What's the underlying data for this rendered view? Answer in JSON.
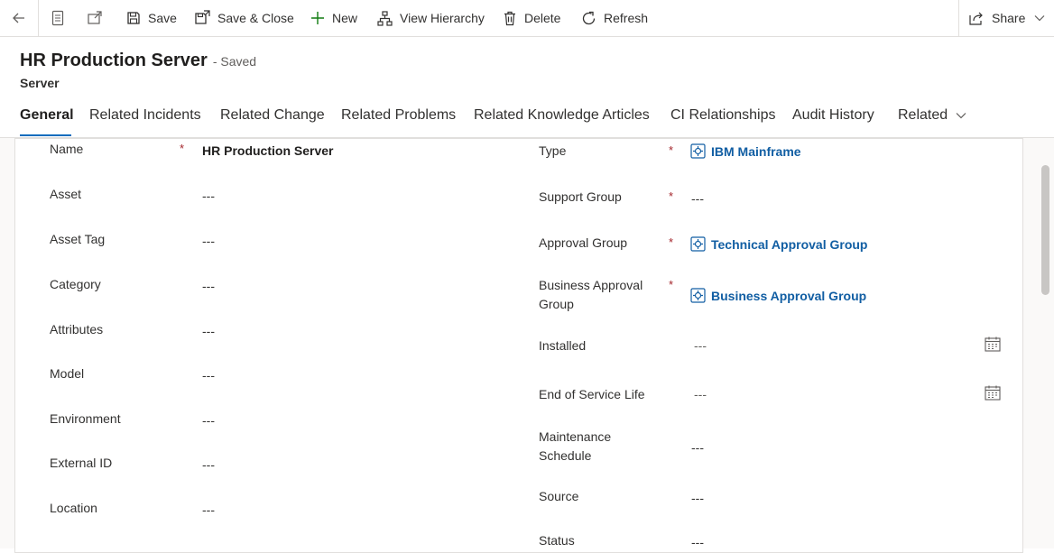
{
  "toolbar": {
    "save": "Save",
    "save_close": "Save & Close",
    "new": "New",
    "view_hierarchy": "View Hierarchy",
    "delete": "Delete",
    "refresh": "Refresh",
    "share": "Share"
  },
  "header": {
    "title": "HR Production Server",
    "saved": "- Saved",
    "entity": "Server"
  },
  "tabs": [
    {
      "label": "General"
    },
    {
      "label": "Related Incidents"
    },
    {
      "label": "Related Change"
    },
    {
      "label": "Related Problems"
    },
    {
      "label": "Related Knowledge Articles"
    },
    {
      "label": "CI Relationships"
    },
    {
      "label": "Audit History"
    },
    {
      "label": "Related"
    }
  ],
  "left_fields": [
    {
      "label": "Name",
      "value": "HR Production Server",
      "required": "*"
    },
    {
      "label": "Asset",
      "value": "---"
    },
    {
      "label": "Asset Tag",
      "value": "---"
    },
    {
      "label": "Category",
      "value": "---"
    },
    {
      "label": "Attributes",
      "value": "---"
    },
    {
      "label": "Model",
      "value": "---"
    },
    {
      "label": "Environment",
      "value": "---"
    },
    {
      "label": "External ID",
      "value": "---"
    },
    {
      "label": "Location",
      "value": "---"
    }
  ],
  "right_fields": {
    "type": {
      "label": "Type",
      "value": "IBM Mainframe",
      "required": "*"
    },
    "support_group": {
      "label": "Support Group",
      "value": "---",
      "required": "*"
    },
    "approval_group": {
      "label": "Approval Group",
      "value": "Technical Approval Group",
      "required": "*"
    },
    "business_approval_group": {
      "label_line1": "Business Approval",
      "label_line2": "Group",
      "value": "Business Approval Group",
      "required": "*"
    },
    "installed": {
      "label": "Installed",
      "value": "---"
    },
    "end_of_service_life": {
      "label": "End of Service Life",
      "value": "---"
    },
    "maintenance_schedule": {
      "label_line1": "Maintenance",
      "label_line2": "Schedule",
      "value": "---"
    },
    "source": {
      "label": "Source",
      "value": "---"
    },
    "status": {
      "label": "Status",
      "value": "---"
    }
  },
  "colors": {
    "accent": "#0f6cbd",
    "link": "#115ea3",
    "required": "#a4262c"
  },
  "icons": [
    "back-arrow-icon",
    "form-icon",
    "popout-icon",
    "save-icon",
    "save-close-icon",
    "plus-icon",
    "hierarchy-icon",
    "trash-icon",
    "refresh-icon",
    "share-icon",
    "chevron-down-icon",
    "calendar-icon",
    "entity-icon"
  ]
}
